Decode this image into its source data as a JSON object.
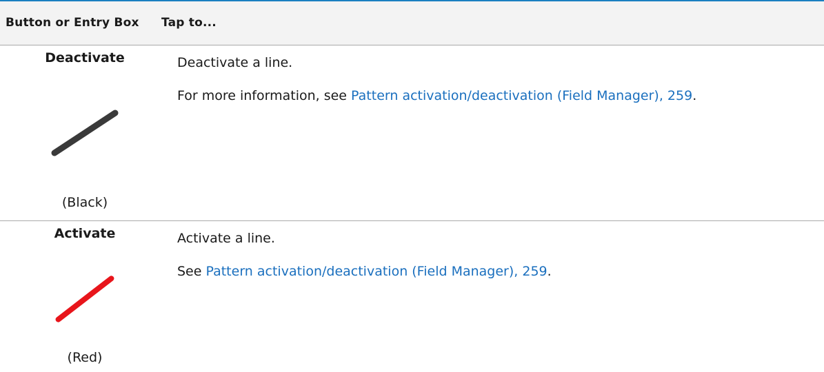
{
  "header": {
    "col1": "Button or Entry Box",
    "col2": "Tap to..."
  },
  "rows": [
    {
      "name": "Deactivate",
      "icon": "black-diagonal-line-icon",
      "icon_color": "#3a3a3a",
      "color_label": "(Black)",
      "description": "Deactivate a line.",
      "more_prefix": "For more information, see ",
      "link_text": "Pattern activation/deactivation (Field Manager), 259",
      "more_suffix": "."
    },
    {
      "name": "Activate",
      "icon": "red-diagonal-line-icon",
      "icon_color": "#e8151b",
      "color_label": "(Red)",
      "description": "Activate a line.",
      "more_prefix": "See ",
      "link_text": "Pattern activation/deactivation (Field Manager), 259",
      "more_suffix": "."
    }
  ],
  "colors": {
    "link": "#1a6fbe",
    "header_rule": "#1a7fc1",
    "header_bg": "#f3f3f3"
  }
}
